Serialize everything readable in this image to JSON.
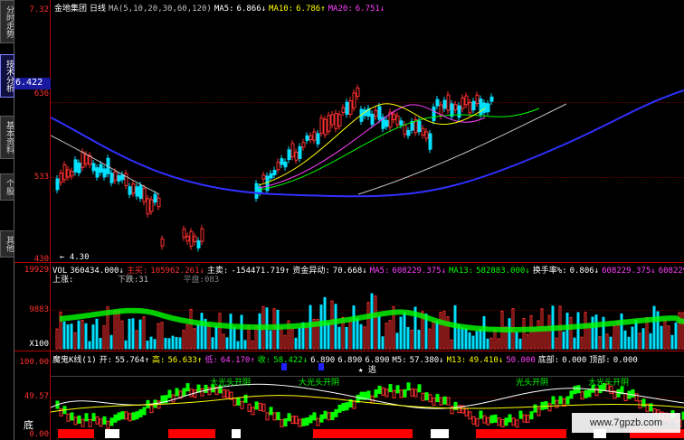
{
  "side_tabs": [
    {
      "label": "分时走势",
      "active": false
    },
    {
      "label": "技术分析",
      "active": true
    },
    {
      "label": "基本资料",
      "active": false
    },
    {
      "label": "个股",
      "active": false
    },
    {
      "label": "其他",
      "active": false
    }
  ],
  "price_panel": {
    "axis_labels": [
      "7.32",
      "6.422",
      "636",
      "533",
      "430"
    ],
    "current_price": "6.422",
    "stock_name": "金地集团",
    "period": "日线",
    "ma_params": "MA(5,10,20,30,60,120)",
    "ma5_label": "MA5:",
    "ma5_value": "6.866↓",
    "ma10_label": "MA10:",
    "ma10_value": "6.786↑",
    "ma20_label": "MA20:",
    "ma20_value": "6.751↓",
    "low_marker": "← 4.30"
  },
  "volume_panel": {
    "axis_labels": [
      "19929",
      "9883",
      "X100"
    ],
    "vol_label": "VOL",
    "vol_value": "360434.000↓",
    "zhumai_label": "主买:",
    "zhumai_value": "105962.261↓",
    "zhumai2_label": "主卖:",
    "zhumai2_value": "-154471.719↑",
    "zijin_label": "资金异动:",
    "zijin_value": "70.668↓",
    "ma5_label": "MA5:",
    "ma5_value": "608229.375↓",
    "ma13_label": "MA13:",
    "ma13_value": "582883.000↓",
    "huanshou_label": "换手率%:",
    "huanshou_value": "0.806↓",
    "extra1": "608229.375↓",
    "extra2": "608229",
    "up_label": "上涨:",
    "down_label": "下跌:31",
    "flat_label": "平盘:083"
  },
  "indicator_panel": {
    "axis_labels": [
      "100.00",
      "49.57",
      "0.00"
    ],
    "name": "魔鬼K线(1)",
    "open_label": "开:",
    "open_value": "55.764↑",
    "high_label": "高:",
    "high_value": "56.633↑",
    "low_label": "低:",
    "low_value": "64.170↑",
    "close_label": "收:",
    "close_value": "58.422↓",
    "v1": "6.890",
    "v2": "6.890",
    "v3": "6.890",
    "m5_label": "M5:",
    "m5_value": "57.380↓",
    "m13_label": "M13:",
    "m13_value": "49.410↓",
    "m_value": "50.000",
    "bottom_label": "底部:",
    "bottom_value": "0.000",
    "top_label": "顶部:",
    "top_value": "0.000",
    "escape_label": "★ 逃",
    "ann_a": "大光头开阴",
    "ann_b": "大光头开阴",
    "ann_c": "光头开阴",
    "ann_d": "大光头开阴",
    "bottom_tag": "底"
  },
  "watermark": "www.7gpzb.com"
}
